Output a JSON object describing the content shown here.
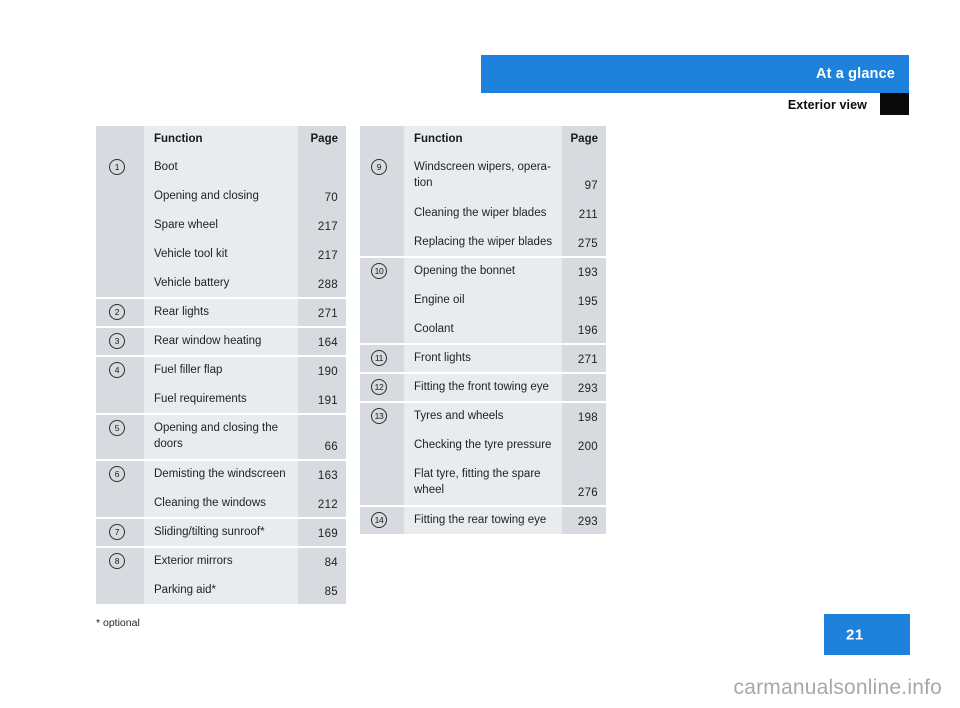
{
  "header": {
    "band_title": "At a glance",
    "subheader_title": "Exterior view"
  },
  "columns": {
    "function": "Function",
    "page": "Page"
  },
  "left_table": [
    {
      "num": "1",
      "text": "Boot",
      "page": "",
      "group_start": true
    },
    {
      "num": "",
      "text": "Opening and closing",
      "page": "70"
    },
    {
      "num": "",
      "text": "Spare wheel",
      "page": "217"
    },
    {
      "num": "",
      "text": "Vehicle tool kit",
      "page": "217"
    },
    {
      "num": "",
      "text": "Vehicle battery",
      "page": "288"
    },
    {
      "num": "2",
      "text": "Rear lights",
      "page": "271",
      "group_start": true
    },
    {
      "num": "3",
      "text": "Rear window heating",
      "page": "164",
      "group_start": true
    },
    {
      "num": "4",
      "text": "Fuel filler flap",
      "page": "190",
      "group_start": true
    },
    {
      "num": "",
      "text": "Fuel requirements",
      "page": "191"
    },
    {
      "num": "5",
      "text": "Opening and closing the doors",
      "page": "66",
      "group_start": true,
      "tall": true
    },
    {
      "num": "6",
      "text": "Demisting the windscreen",
      "page": "163",
      "group_start": true
    },
    {
      "num": "",
      "text": "Cleaning the windows",
      "page": "212"
    },
    {
      "num": "7",
      "text": "Sliding/tilting sunroof*",
      "page": "169",
      "group_start": true
    },
    {
      "num": "8",
      "text": "Exterior mirrors",
      "page": "84",
      "group_start": true
    },
    {
      "num": "",
      "text": "Parking aid*",
      "page": "85"
    }
  ],
  "right_table": [
    {
      "num": "9",
      "text": "Windscreen wipers, opera-tion",
      "page": "97",
      "group_start": true,
      "tall": true
    },
    {
      "num": "",
      "text": "Cleaning the wiper blades",
      "page": "211"
    },
    {
      "num": "",
      "text": "Replacing the wiper blades",
      "page": "275"
    },
    {
      "num": "10",
      "text": "Opening the bonnet",
      "page": "193",
      "group_start": true
    },
    {
      "num": "",
      "text": "Engine oil",
      "page": "195"
    },
    {
      "num": "",
      "text": "Coolant",
      "page": "196"
    },
    {
      "num": "11",
      "text": "Front lights",
      "page": "271",
      "group_start": true
    },
    {
      "num": "12",
      "text": "Fitting the front towing eye",
      "page": "293",
      "group_start": true
    },
    {
      "num": "13",
      "text": "Tyres and wheels",
      "page": "198",
      "group_start": true
    },
    {
      "num": "",
      "text": "Checking the tyre pressure",
      "page": "200"
    },
    {
      "num": "",
      "text": "Flat tyre, fitting the spare wheel",
      "page": "276",
      "tall": true
    },
    {
      "num": "14",
      "text": "Fitting the rear towing eye",
      "page": "293",
      "group_start": true
    }
  ],
  "footnote": "* optional",
  "page_number": "21",
  "watermark": "carmanualsonline.info",
  "colors": {
    "accent_blue": "#1e81dc",
    "row_band_dark": "#d7dbdf",
    "row_band_light": "#e9ecee",
    "marker_black": "#0a0a0a"
  }
}
